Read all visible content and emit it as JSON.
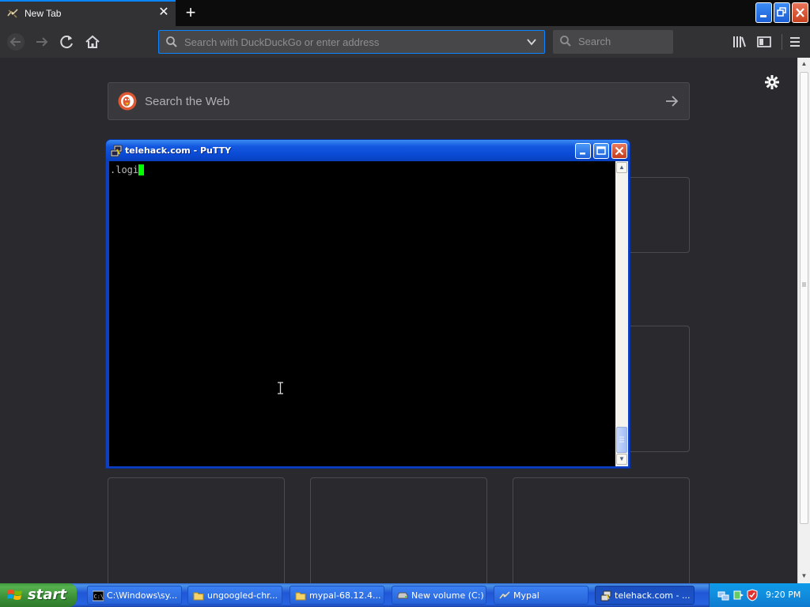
{
  "browser": {
    "tab": {
      "title": "New Tab",
      "close_glyph": "✕"
    },
    "new_tab_glyph": "+",
    "window_buttons": {
      "minimize": "—",
      "restore": "❐",
      "close": "✕"
    },
    "nav": {
      "back_glyph": "←",
      "forward_glyph": "→",
      "reload_glyph": "↻",
      "home_glyph": "⌂"
    },
    "urlbar": {
      "value": "",
      "placeholder": "Search with DuckDuckGo or enter address"
    },
    "searchbar": {
      "value": "",
      "placeholder": "Search"
    },
    "toolbar_icons": [
      "library-icon",
      "sidebar-icon",
      "menu-icon"
    ]
  },
  "newtab": {
    "web_search_label": "Search the Web",
    "top_sites_tiles": 6
  },
  "putty": {
    "title": "telehack.com - PuTTY",
    "buttons": {
      "minimize": "_",
      "maximize": "□",
      "close": "✕"
    },
    "terminal_text": ".logi",
    "cursor_color": "#00ff00"
  },
  "taskbar": {
    "start_label": "start",
    "tasks": [
      {
        "label": "C:\\Windows\\sy...",
        "icon": "cmd-icon",
        "active": false
      },
      {
        "label": "ungoogled-chr...",
        "icon": "folder-icon",
        "active": false
      },
      {
        "label": "mypal-68.12.4...",
        "icon": "folder-icon",
        "active": false
      },
      {
        "label": "New volume (C:)",
        "icon": "drive-icon",
        "active": false
      },
      {
        "label": "Mypal",
        "icon": "mypal-icon",
        "active": false
      },
      {
        "label": "telehack.com - ...",
        "icon": "putty-icon",
        "active": true
      }
    ],
    "clock": "9:20 PM",
    "tray_icons": [
      "network-icon",
      "safely-remove-icon",
      "shield-icon"
    ]
  },
  "colors": {
    "accent": "#0a84ff",
    "page_bg": "#2a2a2e",
    "xp_title_blue": "#0a4ad4",
    "xp_start_green": "#3b9037"
  }
}
